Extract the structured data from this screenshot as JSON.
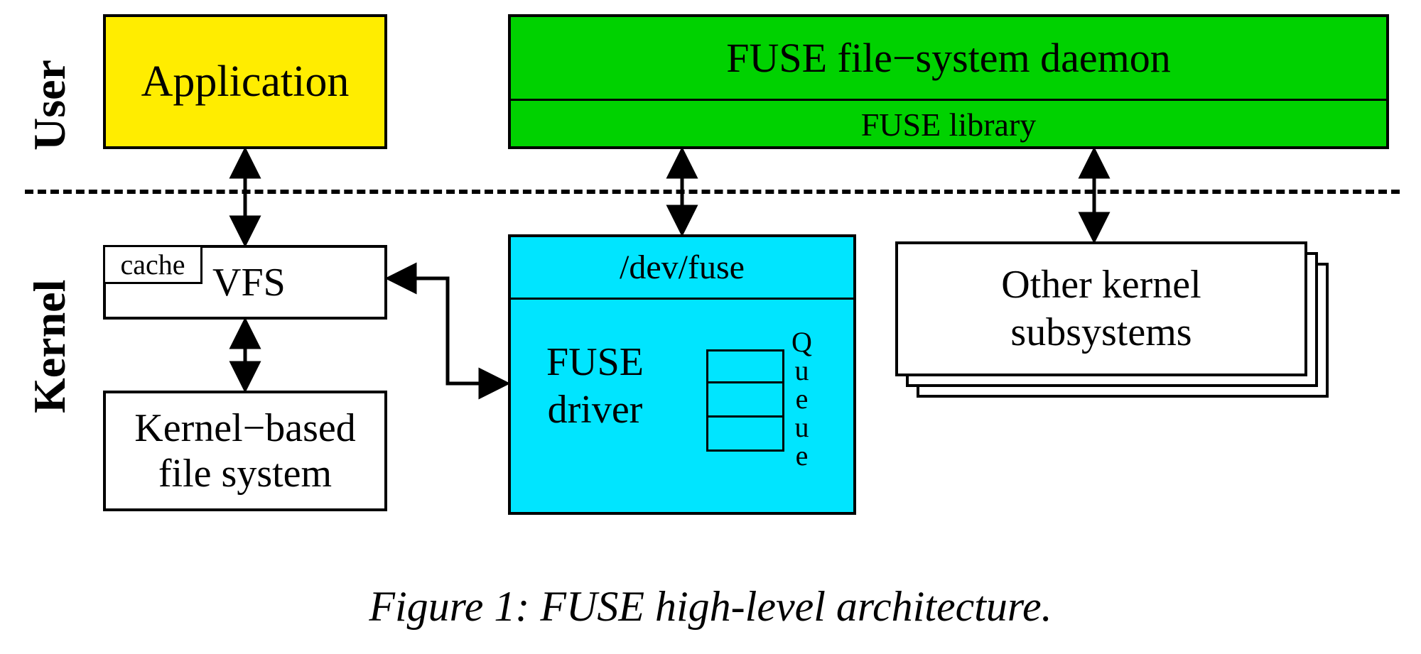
{
  "sections": {
    "user": "User",
    "kernel": "Kernel"
  },
  "boxes": {
    "application": "Application",
    "fuse_daemon": "FUSE file−system daemon",
    "fuse_library": "FUSE library",
    "vfs": "VFS",
    "cache": "cache",
    "kernel_fs_line1": "Kernel−based",
    "kernel_fs_line2": "file system",
    "dev_fuse": "/dev/fuse",
    "fuse_driver_line1": "FUSE",
    "fuse_driver_line2": "driver",
    "queue_letters": [
      "Q",
      "u",
      "e",
      "u",
      "e"
    ],
    "other_kernel_line1": "Other kernel",
    "other_kernel_line2": "subsystems"
  },
  "caption": "Figure 1: FUSE high-level architecture.",
  "colors": {
    "application_bg": "#ffed00",
    "fuse_daemon_bg": "#00d200",
    "fuse_driver_bg": "#00e5ff",
    "white": "#ffffff"
  }
}
